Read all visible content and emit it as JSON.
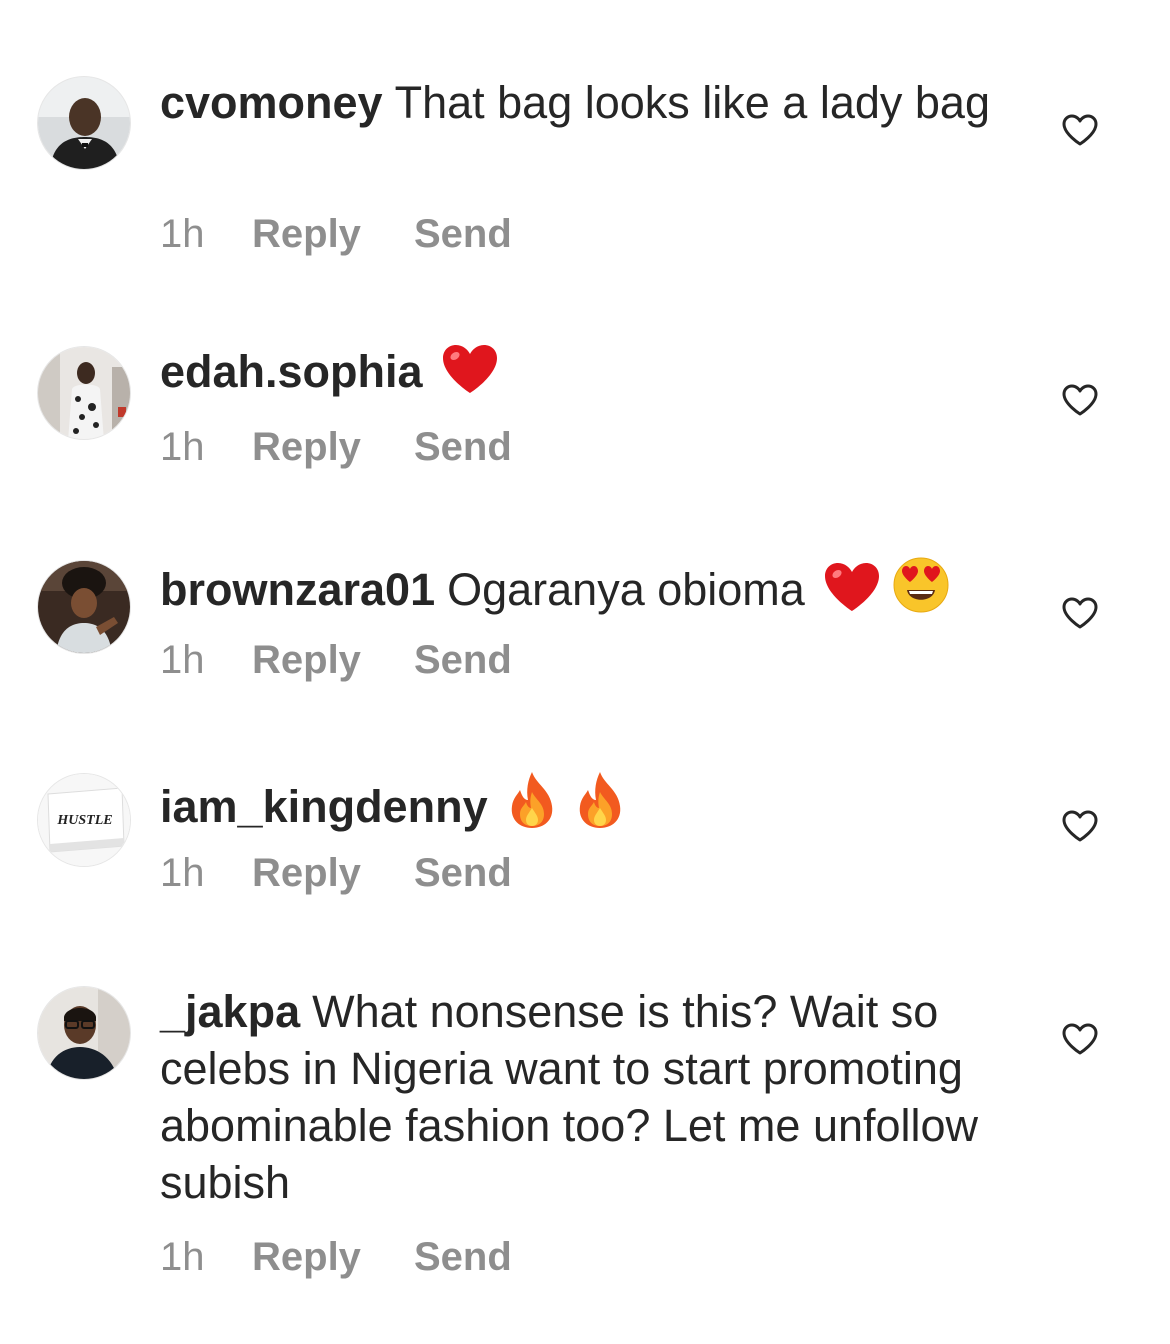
{
  "comments": [
    {
      "username": "cvomoney",
      "text": "That bag looks like a lady bag",
      "emojis": [],
      "time": "1h",
      "reply_label": "Reply",
      "send_label": "Send"
    },
    {
      "username": "edah.sophia",
      "text": "",
      "emojis": [
        "red-heart"
      ],
      "time": "1h",
      "reply_label": "Reply",
      "send_label": "Send"
    },
    {
      "username": "brownzara01",
      "text": "Ogaranya obioma",
      "emojis": [
        "red-heart",
        "heart-eyes"
      ],
      "time": "1h",
      "reply_label": "Reply",
      "send_label": "Send"
    },
    {
      "username": "iam_kingdenny",
      "text": "",
      "emojis": [
        "fire",
        "fire"
      ],
      "time": "1h",
      "reply_label": "Reply",
      "send_label": "Send",
      "avatar_text": "HUSTLE"
    },
    {
      "username": "_jakpa",
      "text": "What nonsense is this? Wait so celebs in Nigeria want to start promoting abominable fashion too? Let me unfollow subish",
      "emojis": [],
      "time": "1h",
      "reply_label": "Reply",
      "send_label": "Send"
    }
  ],
  "colors": {
    "text": "#262626",
    "meta": "#8e8e8e",
    "heart_emoji": "#e0161d",
    "like_outline": "#262626"
  },
  "icons": {
    "like": "heart-outline-icon",
    "avatar": "avatar-photo"
  }
}
